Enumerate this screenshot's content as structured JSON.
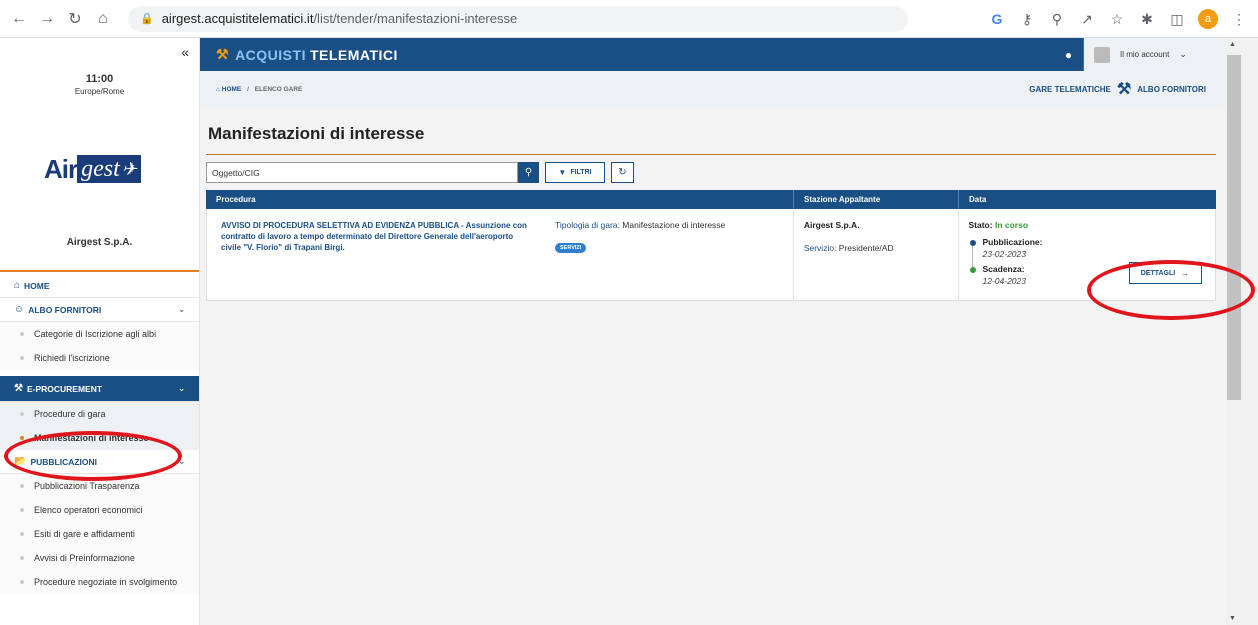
{
  "browser": {
    "url_domain": "airgest.acquistitelematici.it",
    "url_path": "/list/tender/manifestazioni-interesse",
    "profile_initial": "a"
  },
  "sidebar": {
    "time": "11:00",
    "timezone": "Europe/Rome",
    "logo": {
      "air": "Air",
      "gest": "gest"
    },
    "org_name": "Airgest S.p.A.",
    "home": "HOME",
    "albo": "ALBO FORNITORI",
    "albo_items": [
      "Categorie di Iscrizione agli albi",
      "Richiedi l'iscrizione"
    ],
    "eproc": "E-PROCUREMENT",
    "eproc_items": [
      "Procedure di gara",
      "Manifestazioni di interesse"
    ],
    "pubb": "PUBBLICAZIONI",
    "pubb_items": [
      "Pubblicazioni Trasparenza",
      "Elenco operatori economici",
      "Esiti di gare e affidamenti",
      "Avvisi di Preinformazione",
      "Procedure negoziate in svolgimento"
    ]
  },
  "header": {
    "brand_part1": "ACQUISTI",
    "brand_part2": "TELEMATICI",
    "account_label": "Il mio account"
  },
  "breadcrumb": {
    "home": "HOME",
    "current": "ELENCO GARE",
    "gare_link": "GARE TELEMATICHE",
    "albo_link": "ALBO FORNITORI"
  },
  "main": {
    "title": "Manifestazioni di interesse",
    "search_placeholder": "Oggetto/CIG",
    "filter_label": "FILTRI"
  },
  "table": {
    "headers": [
      "Procedura",
      "Stazione Appaltante",
      "Data"
    ],
    "row": {
      "title": "AVVISO DI PROCEDURA SELETTIVA AD EVIDENZA PUBBLICA - Assunzione con contratto di lavoro a tempo determinato del Direttore Generale dell'aeroporto civile \"V. Florio\" di Trapani Birgi.",
      "type_label": "Tipologia di gara:",
      "type_value": "Manifestazione di interesse",
      "tag": "SERVIZI",
      "station": "Airgest S.p.A.",
      "service_label": "Servizio:",
      "service_value": "Presidente/AD",
      "status_label": "Stato:",
      "status_value": "In corso",
      "pub_label": "Pubblicazione:",
      "pub_date": "23-02-2023",
      "due_label": "Scadenza:",
      "due_date": "12-04-2023",
      "details_label": "DETTAGLI"
    }
  },
  "colors": {
    "primary": "#1a4f86",
    "accent": "#e67e22",
    "annotation": "#e0141b",
    "status_green": "#3a9a3a"
  }
}
